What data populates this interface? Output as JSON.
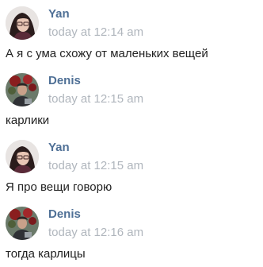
{
  "colors": {
    "author_name": "#4f7096",
    "timestamp": "#b0b6bd",
    "message_text": "#222222",
    "background": "#ffffff"
  },
  "messages": [
    {
      "author": "Yan",
      "avatar": "avatar-yan",
      "time": "today at 12:14 am",
      "text": "А я с ума схожу от маленьких вещей"
    },
    {
      "author": "Denis",
      "avatar": "avatar-denis",
      "time": "today at 12:15 am",
      "text": "карлики"
    },
    {
      "author": "Yan",
      "avatar": "avatar-yan",
      "time": "today at 12:15 am",
      "text": "Я про вещи говорю"
    },
    {
      "author": "Denis",
      "avatar": "avatar-denis",
      "time": "today at 12:16 am",
      "text": "тогда карлицы"
    }
  ]
}
